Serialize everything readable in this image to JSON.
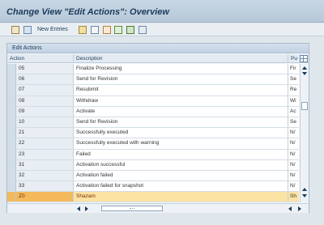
{
  "window": {
    "title": "Change View \"Edit Actions\": Overview"
  },
  "toolbar": {
    "new_entries_label": "New Entries",
    "icons": [
      "edit-pencil-icon",
      "display-icon",
      "copy-icon",
      "delete-icon",
      "undo-icon",
      "select-all-icon",
      "select-block-icon",
      "deselect-all-icon"
    ]
  },
  "panel": {
    "title": "Edit Actions",
    "columns": {
      "action": "Action",
      "description": "Description",
      "pu": "Pu"
    },
    "rows": [
      {
        "action": "05",
        "description": "Finalize Processing",
        "pu": "Fir"
      },
      {
        "action": "06",
        "description": "Send for Revision",
        "pu": "Se"
      },
      {
        "action": "07",
        "description": "Resubmit",
        "pu": "Re"
      },
      {
        "action": "08",
        "description": "Withdraw",
        "pu": "Wi"
      },
      {
        "action": "09",
        "description": "Activate",
        "pu": "Ac"
      },
      {
        "action": "10",
        "description": "Send for Revision",
        "pu": "Se"
      },
      {
        "action": "21",
        "description": "Successfully executed",
        "pu": "N/"
      },
      {
        "action": "22",
        "description": "Successfully executed with warning",
        "pu": "N/"
      },
      {
        "action": "23",
        "description": "Failed",
        "pu": "N/"
      },
      {
        "action": "31",
        "description": "Activation successful",
        "pu": "N/"
      },
      {
        "action": "32",
        "description": "Activation failed",
        "pu": "N/"
      },
      {
        "action": "33",
        "description": "Activation failed for snapshot",
        "pu": "N/"
      },
      {
        "action": "Z0",
        "description": "Shazam",
        "pu": "Sh",
        "selected": true
      }
    ]
  },
  "colors": {
    "selected_row": "#fbe3a3",
    "selected_key": "#f3b95a",
    "title_text": "#1c3b5a"
  }
}
